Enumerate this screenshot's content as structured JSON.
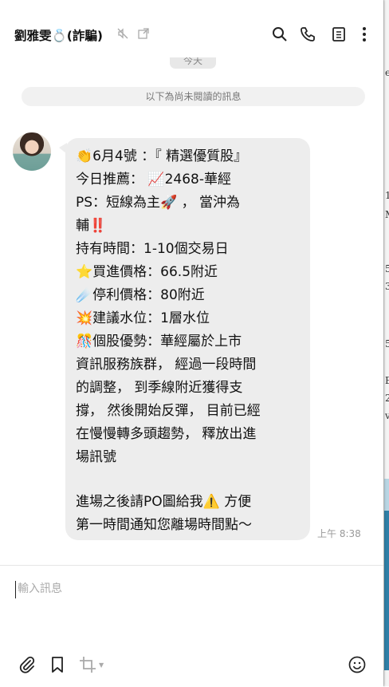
{
  "header": {
    "contact_name": "劉雅雯💍(詐騙)"
  },
  "chat": {
    "date_divider": "今天",
    "unread_divider": "以下為尚未閱讀的訊息",
    "message": {
      "lines": [
        "👏6月4號 ：『 精選優質股』",
        "今日推薦： 📈2468-華經",
        "PS：短線為主🚀 ， 當沖為",
        "輔‼️",
        "持有時間：1-10個交易日",
        "⭐買進價格：66.5附近",
        "☄️停利價格：80附近",
        "💥建議水位：1層水位",
        "🎊個股優勢：華經屬於上市",
        "資訊服務族群， 經過一段時間",
        "的調整， 到季線附近獲得支",
        "撐， 然後開始反彈， 目前已經",
        "在慢慢轉多頭趨勢， 釋放出進",
        "場訊號",
        "",
        "進場之後請PO圖給我⚠️ 方便",
        "第一時間通知您離場時間點～"
      ],
      "time": "上午 8:38"
    }
  },
  "composer": {
    "placeholder": "輸入訊息"
  },
  "background_window": {
    "fragments": [
      "e",
      "1",
      "M",
      "5",
      "3",
      "5",
      "E",
      "2",
      "v"
    ]
  }
}
